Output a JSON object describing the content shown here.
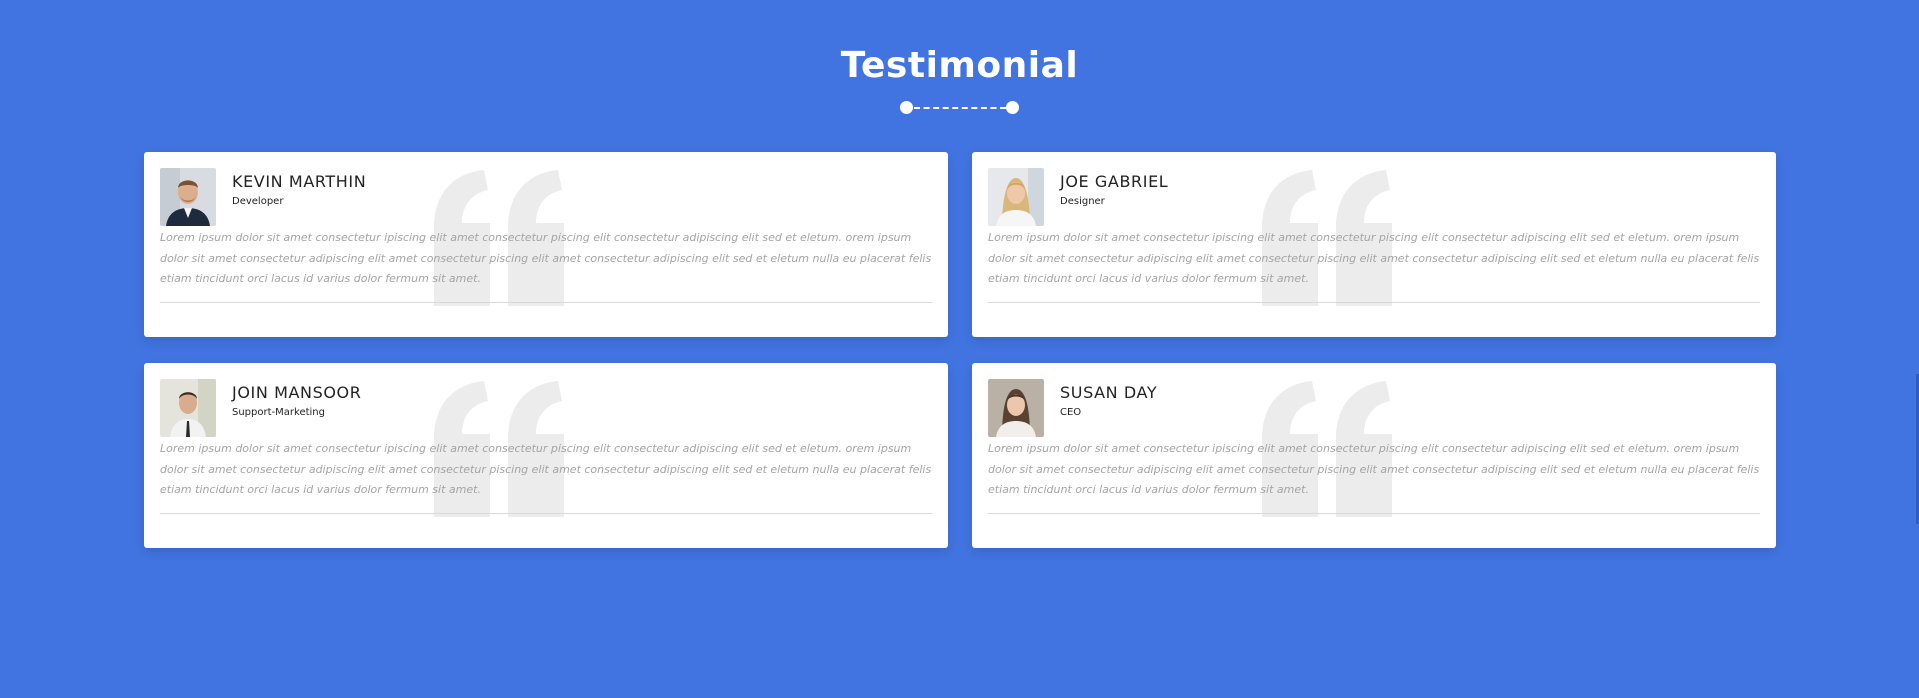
{
  "section": {
    "title": "Testimonial"
  },
  "colors": {
    "background": "#4174e0",
    "card": "#ffffff",
    "quote_mark": "#ececec",
    "body_text": "#a4a4a4"
  },
  "testimonials": [
    {
      "name": "KEVIN MARTHIN",
      "role": "Developer",
      "text": "Lorem ipsum dolor sit amet consectetur ipiscing elit amet consectetur piscing elit consectetur adipiscing elit sed et eletum. orem ipsum dolor sit amet consectetur adipiscing elit amet consectetur piscing elit amet consectetur adipiscing elit sed et eletum nulla eu placerat felis etiam tincidunt orci lacus id varius dolor fermum sit amet.",
      "photo": "man-in-suit-photo"
    },
    {
      "name": "JOE GABRIEL",
      "role": "Designer",
      "text": "Lorem ipsum dolor sit amet consectetur ipiscing elit amet consectetur piscing elit consectetur adipiscing elit sed et eletum. orem ipsum dolor sit amet consectetur adipiscing elit amet consectetur piscing elit amet consectetur adipiscing elit sed et eletum nulla eu placerat felis etiam tincidunt orci lacus id varius dolor fermum sit amet.",
      "photo": "blonde-woman-photo"
    },
    {
      "name": "JOIN MANSOOR",
      "role": "Support-Marketing",
      "text": "Lorem ipsum dolor sit amet consectetur ipiscing elit amet consectetur piscing elit consectetur adipiscing elit sed et eletum. orem ipsum dolor sit amet consectetur adipiscing elit amet consectetur piscing elit amet consectetur adipiscing elit sed et eletum nulla eu placerat felis etiam tincidunt orci lacus id varius dolor fermum sit amet.",
      "photo": "man-in-shirt-photo"
    },
    {
      "name": "SUSAN DAY",
      "role": "CEO",
      "text": "Lorem ipsum dolor sit amet consectetur ipiscing elit amet consectetur piscing elit consectetur adipiscing elit sed et eletum. orem ipsum dolor sit amet consectetur adipiscing elit amet consectetur piscing elit amet consectetur adipiscing elit sed et eletum nulla eu placerat felis etiam tincidunt orci lacus id varius dolor fermum sit amet.",
      "photo": "dark-haired-woman-photo"
    }
  ]
}
